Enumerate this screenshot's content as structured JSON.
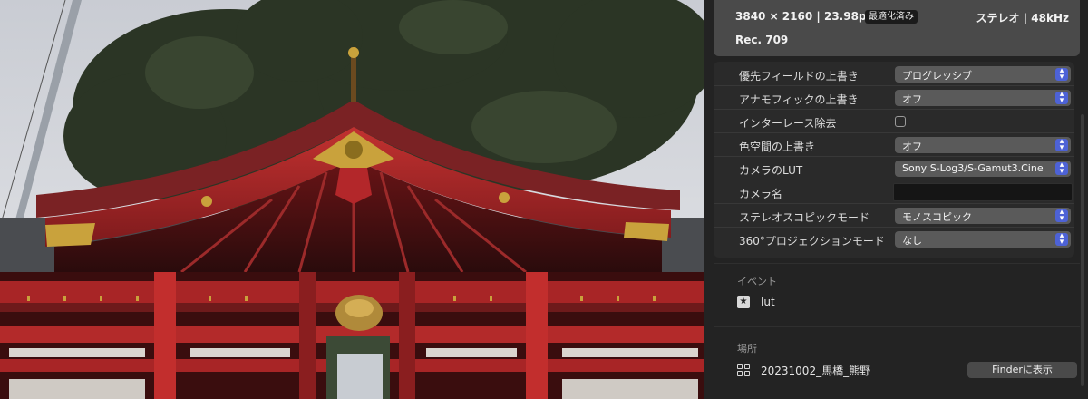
{
  "info": {
    "resolution": "3840 × 2160",
    "frame_rate": "23.98p",
    "status_badge": "最適化済み",
    "audio": "ステレオ | 48kHz",
    "color_space": "Rec. 709"
  },
  "settings": [
    {
      "label": "優先フィールドの上書き",
      "type": "popup",
      "value": "プログレッシブ"
    },
    {
      "label": "アナモフィックの上書き",
      "type": "popup",
      "value": "オフ"
    },
    {
      "label": "インターレース除去",
      "type": "checkbox",
      "checked": false
    },
    {
      "label": "色空間の上書き",
      "type": "popup",
      "value": "オフ"
    },
    {
      "label": "カメラのLUT",
      "type": "popup",
      "value": "Sony S-Log3/S-Gamut3.Cine"
    },
    {
      "label": "カメラ名",
      "type": "text",
      "value": ""
    },
    {
      "label": "ステレオスコピックモード",
      "type": "popup",
      "value": "モノスコピック"
    },
    {
      "label": "360°プロジェクションモード",
      "type": "popup",
      "value": "なし"
    }
  ],
  "events": {
    "title": "イベント",
    "item": "lut",
    "icon": "star-icon"
  },
  "location": {
    "title": "場所",
    "item": "20231002_馬橋_熊野",
    "icon": "grid-icon",
    "finder_button": "Finderに表示"
  },
  "colors": {
    "accent": "#4d62d6",
    "shrine_red": "#b8292a",
    "panel": "#232323"
  }
}
